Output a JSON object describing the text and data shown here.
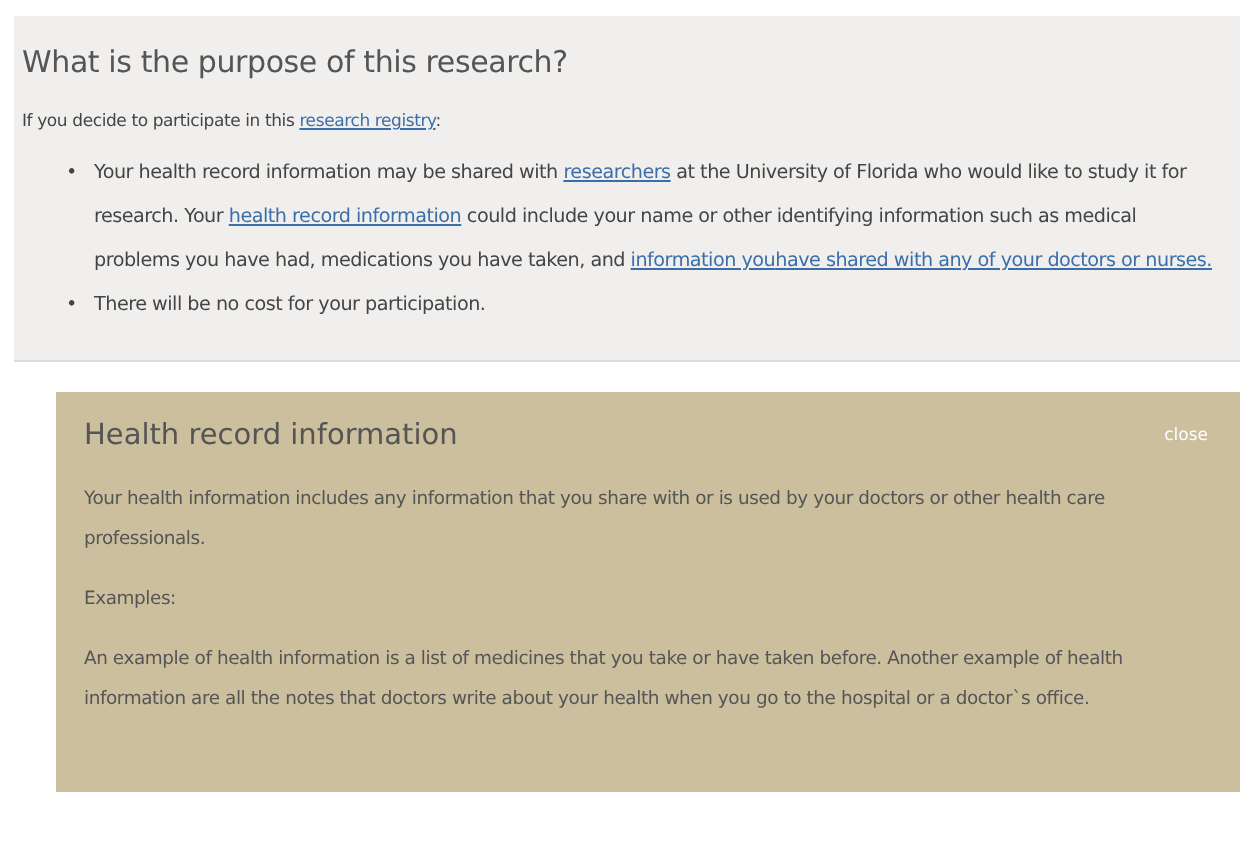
{
  "section": {
    "title": "What is the purpose of this research?",
    "intro": [
      {
        "kind": "text",
        "text": "If you decide to participate in this "
      },
      {
        "kind": "link",
        "text": "research registry"
      },
      {
        "kind": "text",
        "text": ":"
      }
    ],
    "bullets": [
      {
        "marker": "•",
        "segments": [
          {
            "kind": "text",
            "text": "Your health record information may be shared with "
          },
          {
            "kind": "link",
            "text": "researchers"
          },
          {
            "kind": "text",
            "text": " at the University of Florida who would like to study it for research. Your "
          },
          {
            "kind": "link",
            "text": "health record information"
          },
          {
            "kind": "text",
            "text": " could include your name or other identifying information such as medical problems you have had, medications you have taken, and "
          },
          {
            "kind": "link",
            "text": "information you"
          },
          {
            "kind": "link",
            "text": "have shared with any of your doctors or nurses."
          }
        ]
      },
      {
        "marker": "•",
        "segments": [
          {
            "kind": "text",
            "text": "There will be no cost for your participation."
          }
        ]
      }
    ]
  },
  "popup": {
    "title": "Health record information",
    "close": "close",
    "paragraphs": [
      "Your health information includes any information that you share with or is used by your doctors or other health care professionals.",
      "Examples:",
      "An example of health information is a list of medicines that you take or have taken before. Another example of health information are all the notes that doctors write about your health when you go to the hospital or a doctor`s office."
    ]
  }
}
